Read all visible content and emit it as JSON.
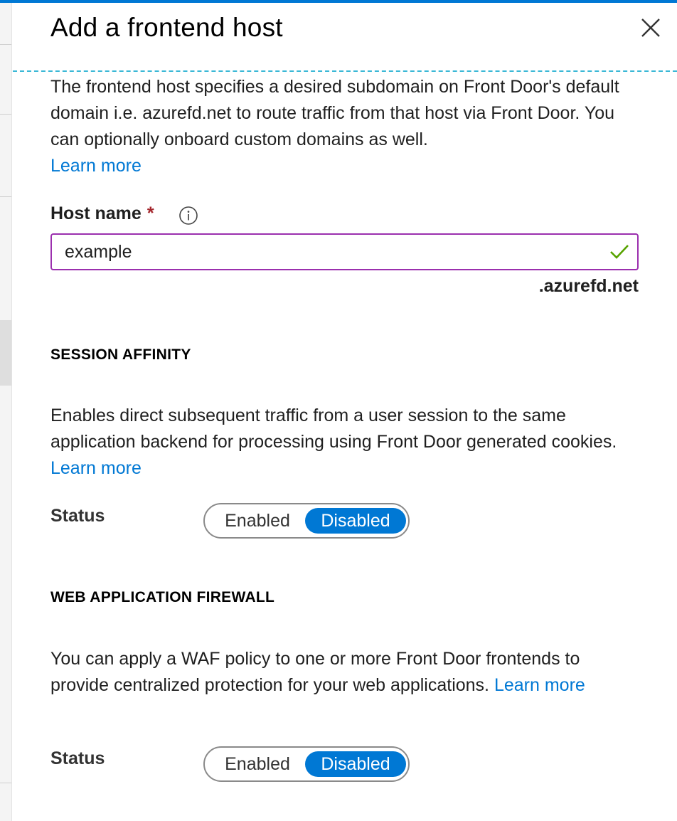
{
  "panel": {
    "title": "Add a frontend host",
    "close_icon": "close-icon"
  },
  "intro": {
    "text": "The frontend host specifies a desired subdomain on Front Door's default domain i.e. azurefd.net to route traffic from that host via Front Door. You can optionally onboard custom domains as well.",
    "link": "Learn more"
  },
  "host_name": {
    "label": "Host name",
    "required_mark": "*",
    "info_icon": "info-icon",
    "value": "example",
    "valid_icon": "checkmark-icon",
    "suffix": ".azurefd.net"
  },
  "session_affinity": {
    "heading": "SESSION AFFINITY",
    "text": "Enables direct subsequent traffic from a user session to the same application backend for processing using Front Door generated cookies.",
    "link": "Learn more",
    "status_label": "Status",
    "options": [
      "Enabled",
      "Disabled"
    ],
    "selected": "Disabled"
  },
  "waf": {
    "heading": "WEB APPLICATION FIREWALL",
    "text": "You can apply a WAF policy to one or more Front Door frontends to provide centralized protection for your web applications.",
    "link": "Learn more",
    "status_label": "Status",
    "options": [
      "Enabled",
      "Disabled"
    ],
    "selected": "Disabled"
  },
  "colors": {
    "accent": "#0078d4",
    "input_border": "#9b2fae",
    "valid": "#57a300",
    "required": "#a4262c",
    "divider": "#3bb8d6"
  }
}
